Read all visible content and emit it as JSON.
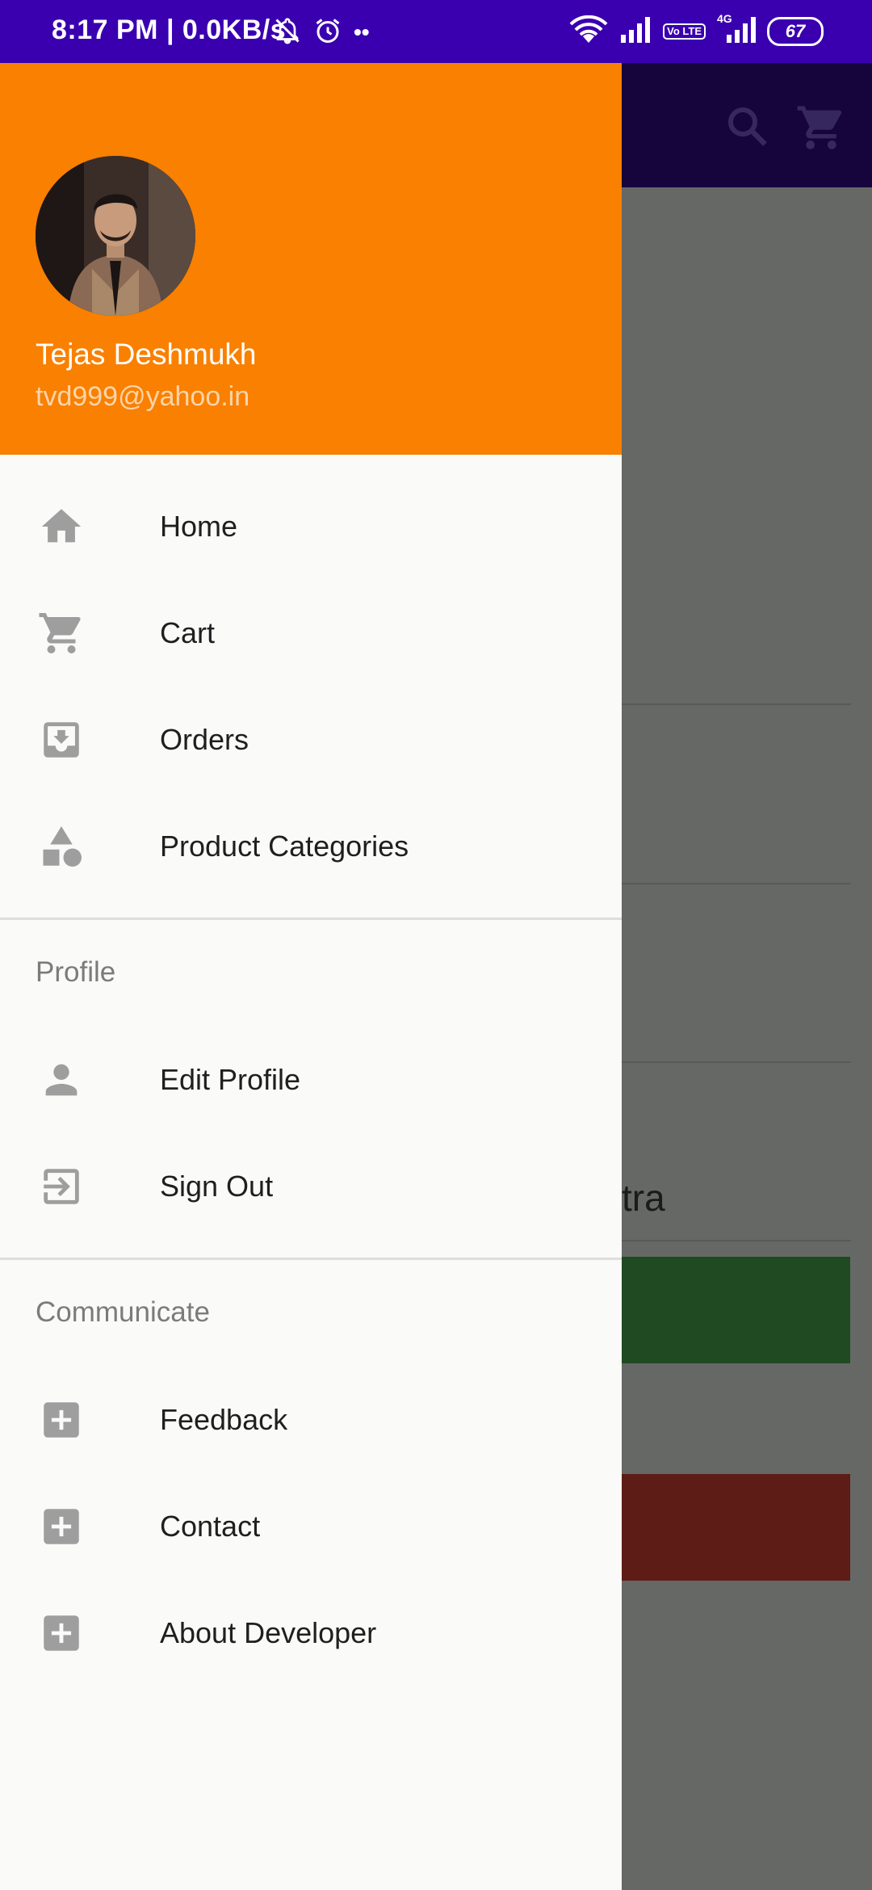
{
  "status_bar": {
    "time": "8:17 PM | 0.0KB/s",
    "network_4g": "4G",
    "volte": "Vo LTE",
    "battery": "67"
  },
  "background": {
    "partial_text": "tra",
    "colors": {
      "toolbar": "#16053d",
      "green_button": "#1f4a22",
      "red_button": "#5e1c17"
    }
  },
  "drawer": {
    "header": {
      "name": "Tejas Deshmukh",
      "email": "tvd999@yahoo.in",
      "color": "#f98000"
    },
    "main_items": [
      {
        "label": "Home",
        "icon": "home-icon"
      },
      {
        "label": "Cart",
        "icon": "cart-icon"
      },
      {
        "label": "Orders",
        "icon": "orders-icon"
      },
      {
        "label": "Product Categories",
        "icon": "categories-icon"
      }
    ],
    "profile_section": {
      "title": "Profile",
      "items": [
        {
          "label": "Edit Profile",
          "icon": "person-icon"
        },
        {
          "label": "Sign Out",
          "icon": "sign-out-icon"
        }
      ]
    },
    "communicate_section": {
      "title": "Communicate",
      "items": [
        {
          "label": "Feedback",
          "icon": "add-box-icon"
        },
        {
          "label": "Contact",
          "icon": "add-box-icon"
        },
        {
          "label": "About Developer",
          "icon": "add-box-icon"
        }
      ]
    }
  }
}
